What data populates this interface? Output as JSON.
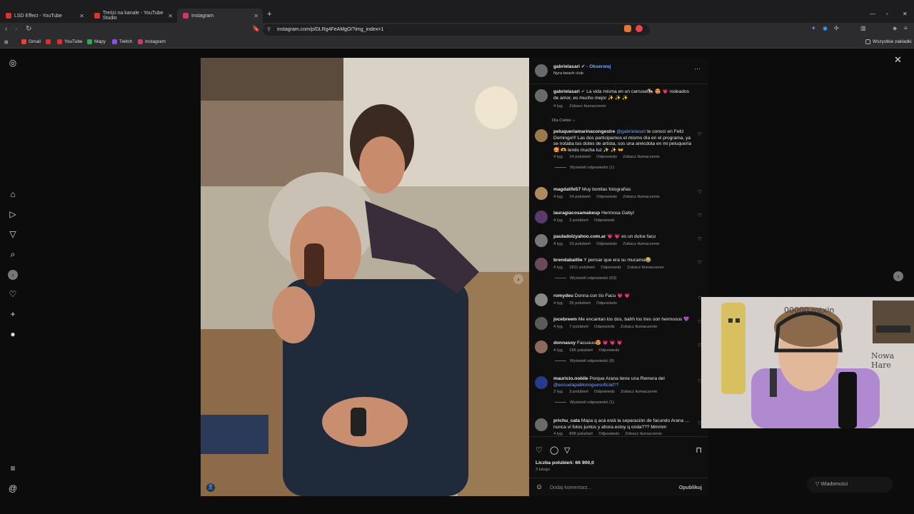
{
  "tabs": [
    {
      "label": "LSD Effect - YouTube",
      "color": "#e0302a"
    },
    {
      "label": "Treści na kanale - YouTube Studio",
      "color": "#e0302a"
    },
    {
      "label": "Instagram",
      "color": "#d6336c",
      "active": true
    }
  ],
  "urlbar": {
    "url": "instagram.com/p/DLRg4FeAMgO/?img_index=1"
  },
  "bookmarks": [
    {
      "label": "Gmail",
      "color": "#ea4335"
    },
    {
      "label": "",
      "color": "#e0302a"
    },
    {
      "label": "YouTube",
      "color": "#e0302a"
    },
    {
      "label": "Mapy",
      "color": "#34a853"
    },
    {
      "label": "Twitch",
      "color": "#9146ff"
    },
    {
      "label": "Instagram",
      "color": "#d6336c"
    }
  ],
  "bookmarks_all": "Wszystkie zakładki",
  "post": {
    "username": "gabrielasari",
    "follow": "Obserwuj",
    "location": "Nyra beach club",
    "caption": "La vida misma en un carrusel🎠 😍 💗 rodeados de amor, es mucho mejor ✨ ✨ ✨",
    "caption_time": "4 tyg.",
    "caption_translate": "Zobacz tłumaczenie",
    "section_label": "Dla Ciebie ⌵"
  },
  "comments": [
    {
      "user": "peluqueriamarinacongestre",
      "mention": "@gabrielasari",
      "text": "te conocí en Feliz Domingo!!! Las dos participamos el mismo día en el programa, ya se notaba tus dotes de artista, sos una anécdota en mi peluquería 🥰 🫶 tenés mucha luz ✨ ✨ 👐",
      "time": "4 tyg.",
      "likes": "14 polubień",
      "reply": "Odpowiedz",
      "translate": "Zobacz tłumaczenie",
      "replies": "Wyświetl odpowiedzi (1)"
    },
    {
      "user": "magdalife57",
      "text": "Muy bonitas fotografías",
      "time": "4 tyg.",
      "likes": "14 polubień",
      "reply": "Odpowiedz",
      "translate": "Zobacz tłumaczenie"
    },
    {
      "user": "lauragiacosamakeup",
      "text": "Hermosa Gaby!",
      "time": "4 tyg.",
      "likes": "2 polubień",
      "reply": "Odpowiedz"
    },
    {
      "user": "pauladolzyahoo.com.ar",
      "text": "💗 💗 es un dulce facu",
      "time": "4 tyg.",
      "likes": "19 polubień",
      "reply": "Odpowiedz",
      "translate": "Zobacz tłumaczenie"
    },
    {
      "user": "brendabaillie",
      "text": "Y pensar que era su mucama😂",
      "time": "4 tyg.",
      "likes": "1811 polubień",
      "reply": "Odpowiedz",
      "translate": "Zobacz tłumaczenie",
      "replies": "Wyświetl odpowiedzi (63)"
    },
    {
      "user": "romydeu",
      "text": "Donna con tío Facu 💗 💗",
      "time": "4 tyg.",
      "likes": "25 polubień",
      "reply": "Odpowiedz"
    },
    {
      "user": "jocebreem",
      "text": "Me encantan los dos, bahh los tres son hermosos 💜",
      "time": "4 tyg.",
      "likes": "7 polubień",
      "reply": "Odpowiedz",
      "translate": "Zobacz tłumaczenie"
    },
    {
      "user": "donnasoy",
      "text": "Facuuuu😍 💗 💗 💗",
      "time": "4 tyg.",
      "likes": "196 polubień",
      "reply": "Odpowiedz",
      "replies": "Wyświetl odpowiedzi (8)"
    },
    {
      "user": "mauricio.nobile",
      "text": "Porque Arana tiene una Remera del",
      "mention2": "@escuelapablonoguesoficial??",
      "time": "2 tyg.",
      "likes": "3 polubień",
      "reply": "Odpowiedz",
      "translate": "Zobacz tłumaczenie",
      "replies": "Wyświetl odpowiedzi (1)"
    },
    {
      "user": "prichu_cata",
      "text": "Mapa q acá está la separación de facundo Arana … nunca vi fotos juntos y ahora estoy q onda??? Mmmm",
      "time": "4 tyg.",
      "likes": "898 polubień",
      "reply": "Odpowiedz",
      "translate": "Zobacz tłumaczenie"
    }
  ],
  "footer": {
    "likes": "Liczba polubień: 66 900,0",
    "date": "3 lutego",
    "add_comment": "Dodaj komentarz...",
    "publish": "Opublikuj"
  },
  "messages": "Wiadomości",
  "webcam": {
    "board_text": "00000 rotxin",
    "poster_text": "Nowa Hare"
  }
}
